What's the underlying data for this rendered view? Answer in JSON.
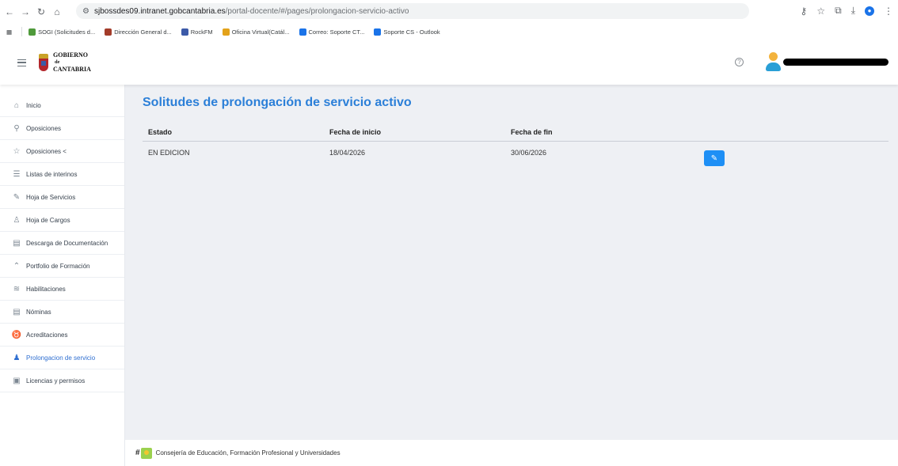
{
  "browser": {
    "url_host": "sjbossdes09.intranet.gobcantabria.es",
    "url_path": "/portal-docente/#/pages/prolongacion-servicio-activo",
    "bookmarks": [
      {
        "label": "SOGI (Solicitudes d...",
        "color": "#4f9a3b"
      },
      {
        "label": "Dirección General d...",
        "color": "#a33c2a"
      },
      {
        "label": "RockFM",
        "color": "#3c5aa8"
      },
      {
        "label": "Oficina Virtual(Catál...",
        "color": "#e3a21a"
      },
      {
        "label": "Correo: Soporte CT...",
        "color": "#1a73e8"
      },
      {
        "label": "Soporte CS - Outlook",
        "color": "#1a73e8"
      }
    ]
  },
  "header": {
    "logo_line1": "GOBIERNO",
    "logo_line2": "de",
    "logo_line3": "CANTABRIA"
  },
  "sidebar": {
    "items": [
      {
        "label": "Inicio",
        "icon": "home-icon"
      },
      {
        "label": "Oposiciones",
        "icon": "user-search-icon"
      },
      {
        "label": "Oposiciones  <",
        "icon": "star-icon"
      },
      {
        "label": "Listas de interinos",
        "icon": "list-icon"
      },
      {
        "label": "Hoja de Servicios",
        "icon": "wrench-icon"
      },
      {
        "label": "Hoja de Cargos",
        "icon": "users-icon"
      },
      {
        "label": "Descarga de Documentación",
        "icon": "file-download-icon"
      },
      {
        "label": "Portfolio de Formación",
        "icon": "graduation-cap-icon"
      },
      {
        "label": "Habilitaciones",
        "icon": "layers-icon"
      },
      {
        "label": "Nóminas",
        "icon": "document-icon"
      },
      {
        "label": "Acreditaciones",
        "icon": "medal-icon"
      },
      {
        "label": "Prolongacion de servicio",
        "icon": "user-plus-icon",
        "active": true
      },
      {
        "label": "Licencias y permisos",
        "icon": "clipboard-icon"
      }
    ]
  },
  "main": {
    "title": "Solitudes de prolongación de servicio activo",
    "table": {
      "columns": [
        "Estado",
        "Fecha de inicio",
        "Fecha de fin"
      ],
      "rows": [
        {
          "estado": "EN EDICION",
          "inicio": "18/04/2026",
          "fin": "30/06/2026"
        }
      ]
    }
  },
  "footer": {
    "text": "Consejería de Educación, Formación Profesional y Universidades"
  },
  "colors": {
    "accent": "#2b7fd8",
    "button": "#1e8ff5",
    "active_nav": "#2f6fd1",
    "main_bg": "#eef0f4"
  }
}
